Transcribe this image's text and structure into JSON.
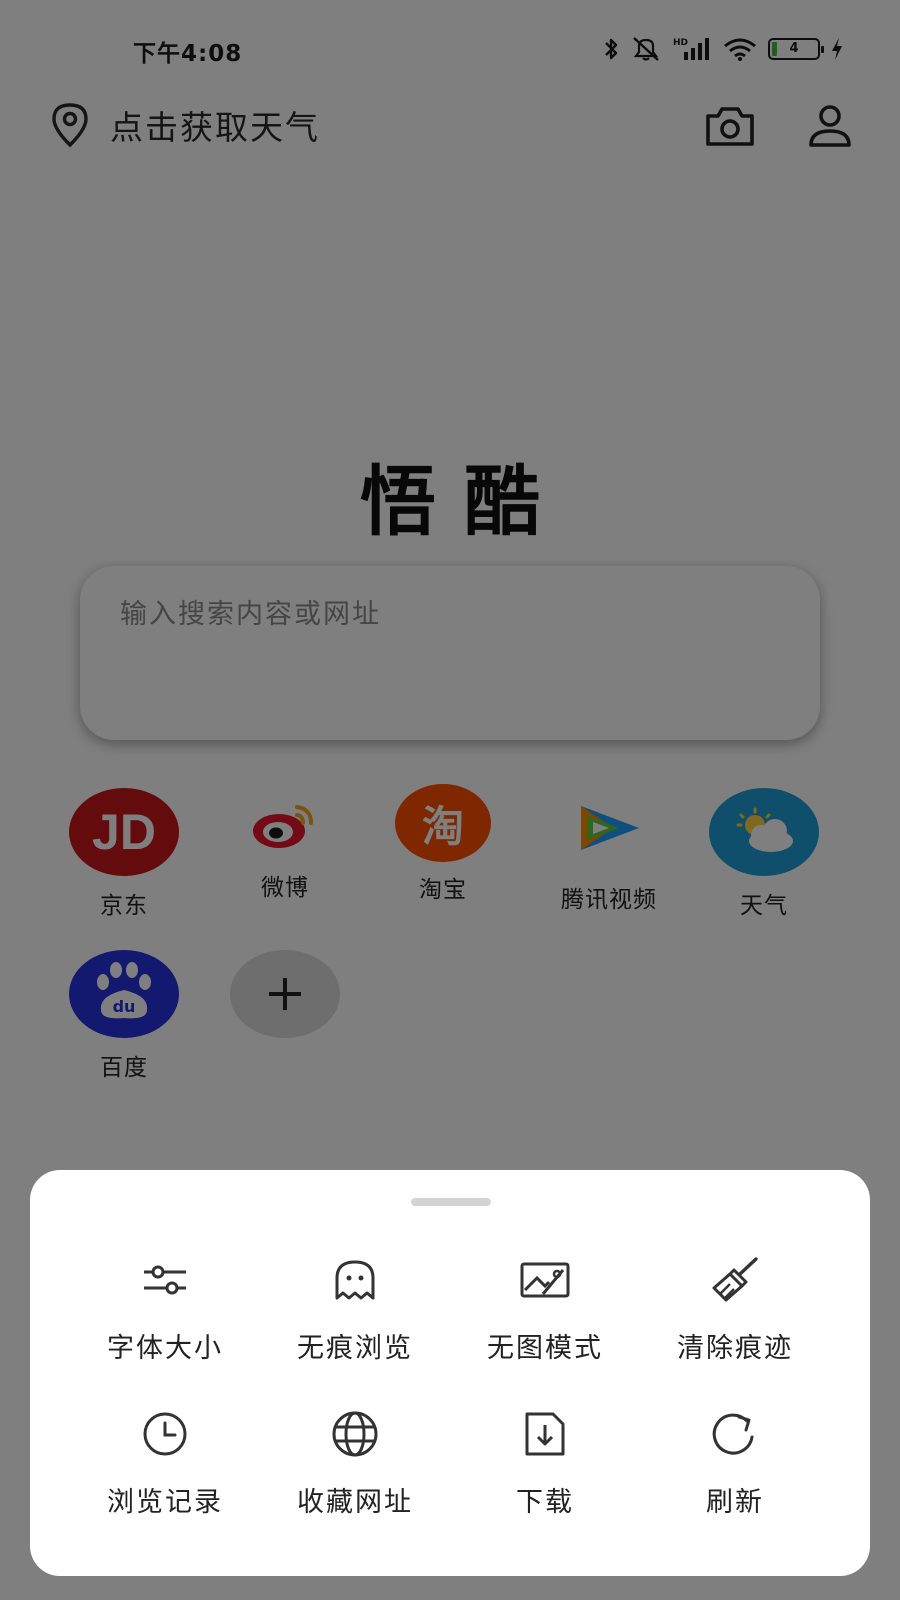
{
  "status_bar": {
    "time": "下午4:08",
    "battery_level": "4",
    "network_label": "HD"
  },
  "header": {
    "weather_prompt": "点击获取天气"
  },
  "logo_text": "悟酷",
  "search": {
    "placeholder": "输入搜索内容或网址"
  },
  "shortcuts": [
    {
      "label": "京东",
      "icon": "jd-icon",
      "glyph": "JD",
      "color": "#c8161d"
    },
    {
      "label": "微博",
      "icon": "weibo-icon",
      "color": "#e6162d"
    },
    {
      "label": "淘宝",
      "icon": "taobao-icon",
      "glyph": "淘",
      "color": "#ff5000"
    },
    {
      "label": "腾讯视频",
      "icon": "tencent-video-icon",
      "color": "#1e9fff"
    },
    {
      "label": "天气",
      "icon": "weather-icon",
      "color": "#1f9fd6"
    },
    {
      "label": "百度",
      "icon": "baidu-icon",
      "glyph": "du",
      "color": "#2932e1"
    },
    {
      "label": "",
      "icon": "add-icon",
      "color": "#dcdcdc"
    }
  ],
  "menu": {
    "items": [
      {
        "label": "字体大小",
        "icon": "font-size-sliders-icon"
      },
      {
        "label": "无痕浏览",
        "icon": "incognito-ghost-icon"
      },
      {
        "label": "无图模式",
        "icon": "no-image-icon"
      },
      {
        "label": "清除痕迹",
        "icon": "clear-broom-icon"
      },
      {
        "label": "浏览记录",
        "icon": "history-clock-icon"
      },
      {
        "label": "收藏网址",
        "icon": "bookmark-globe-icon"
      },
      {
        "label": "下载",
        "icon": "download-icon"
      },
      {
        "label": "刷新",
        "icon": "refresh-icon"
      }
    ]
  }
}
